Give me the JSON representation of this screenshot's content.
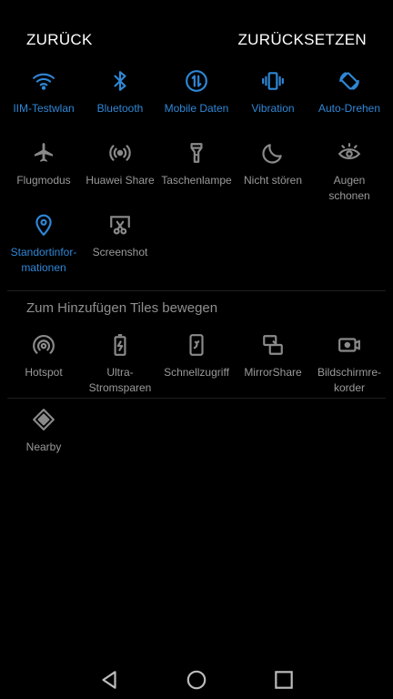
{
  "header": {
    "back_label": "ZURÜCK",
    "reset_label": "ZURÜCKSETZEN"
  },
  "active_tiles": [
    {
      "label": "IIM-Testwlan",
      "icon": "wifi-icon"
    },
    {
      "label": "Bluetooth",
      "icon": "bluetooth-icon"
    },
    {
      "label": "Mobile Daten",
      "icon": "mobile-data-icon"
    },
    {
      "label": "Vibration",
      "icon": "vibration-icon"
    },
    {
      "label": "Auto-Drehen",
      "icon": "auto-rotate-icon"
    },
    {
      "label": "Flugmodus",
      "icon": "airplane-icon"
    },
    {
      "label": "Huawei Share",
      "icon": "huawei-share-icon"
    },
    {
      "label": "Taschenlampe",
      "icon": "flashlight-icon"
    },
    {
      "label": "Nicht stören",
      "icon": "moon-icon"
    },
    {
      "label": "Augen\nschonen",
      "icon": "eye-icon"
    },
    {
      "label": "Standortinfor-\nmationen",
      "icon": "location-icon"
    },
    {
      "label": "Screenshot",
      "icon": "screenshot-icon"
    }
  ],
  "add_section": {
    "title": "Zum Hinzufügen Tiles bewegen"
  },
  "available_tiles": [
    {
      "label": "Hotspot",
      "icon": "hotspot-icon"
    },
    {
      "label": "Ultra-\nStromsparen",
      "icon": "battery-saver-icon"
    },
    {
      "label": "Schnellzugriff",
      "icon": "quick-access-icon"
    },
    {
      "label": "MirrorShare",
      "icon": "mirror-share-icon"
    },
    {
      "label": "Bildschirmre-\nkorder",
      "icon": "screen-recorder-icon"
    },
    {
      "label": "Nearby",
      "icon": "nearby-icon"
    }
  ],
  "colors": {
    "active": "#2f87d6",
    "inactive": "#8a8a8a",
    "background": "#000000"
  },
  "navbar": {
    "back_icon": "back-triangle-icon",
    "home_icon": "home-circle-icon",
    "recents_icon": "recents-square-icon"
  }
}
